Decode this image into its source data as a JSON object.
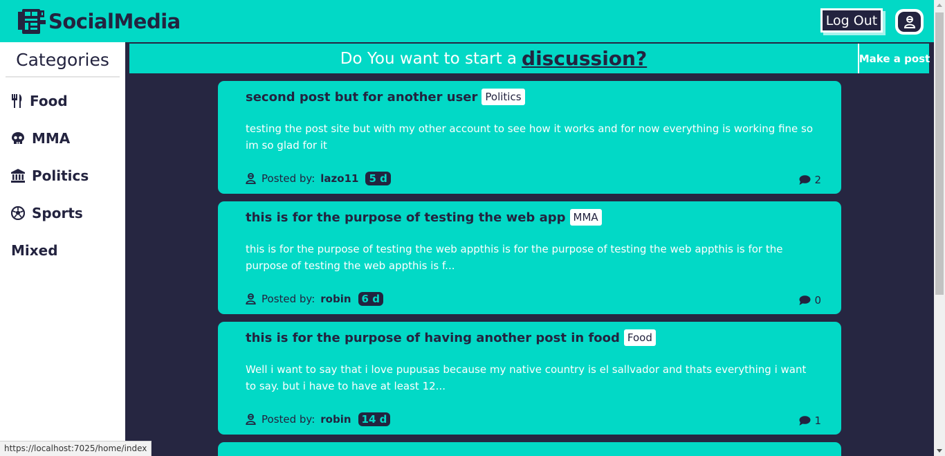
{
  "header": {
    "brand": "SocialMedia",
    "logout_label": "Log Out",
    "profile_icon": "user-icon"
  },
  "sidebar": {
    "title": "Categories",
    "items": [
      {
        "label": "Food",
        "icon": "utensils-icon"
      },
      {
        "label": "MMA",
        "icon": "skull-icon"
      },
      {
        "label": "Politics",
        "icon": "landmark-icon"
      },
      {
        "label": "Sports",
        "icon": "soccer-ball-icon"
      },
      {
        "label": "Mixed",
        "icon": ""
      }
    ]
  },
  "banner": {
    "prompt": "Do You want to start a",
    "link": "discussion?",
    "make_post": "Make a post"
  },
  "posts": [
    {
      "title": "second post but for another user",
      "tag": "Politics",
      "body": "testing the post site but with my other account to see how it works and for now everything is working fine so im so glad for it",
      "posted_by_label": "Posted by:",
      "author": "lazo11",
      "age": "5 d",
      "comments": "2"
    },
    {
      "title": "this is for the purpose of testing the web app",
      "tag": "MMA",
      "body": "this is for the purpose of testing the web appthis is for the purpose of testing the web appthis is for the purpose of testing the web appthis is f...",
      "posted_by_label": "Posted by:",
      "author": "robin",
      "age": "6 d",
      "comments": "0"
    },
    {
      "title": "this is for the purpose of having another post in food",
      "tag": "Food",
      "body": "Well i want to say that i love pupusas because my native country is el sallvador and thats everything i want to say. but i have to have at least 12...",
      "posted_by_label": "Posted by:",
      "author": "robin",
      "age": "14 d",
      "comments": "1"
    }
  ],
  "status_bar": {
    "url": "https://localhost:7025/home/index"
  },
  "colors": {
    "accent": "#02d9c6",
    "dark": "#23233f",
    "background": "#262641"
  }
}
